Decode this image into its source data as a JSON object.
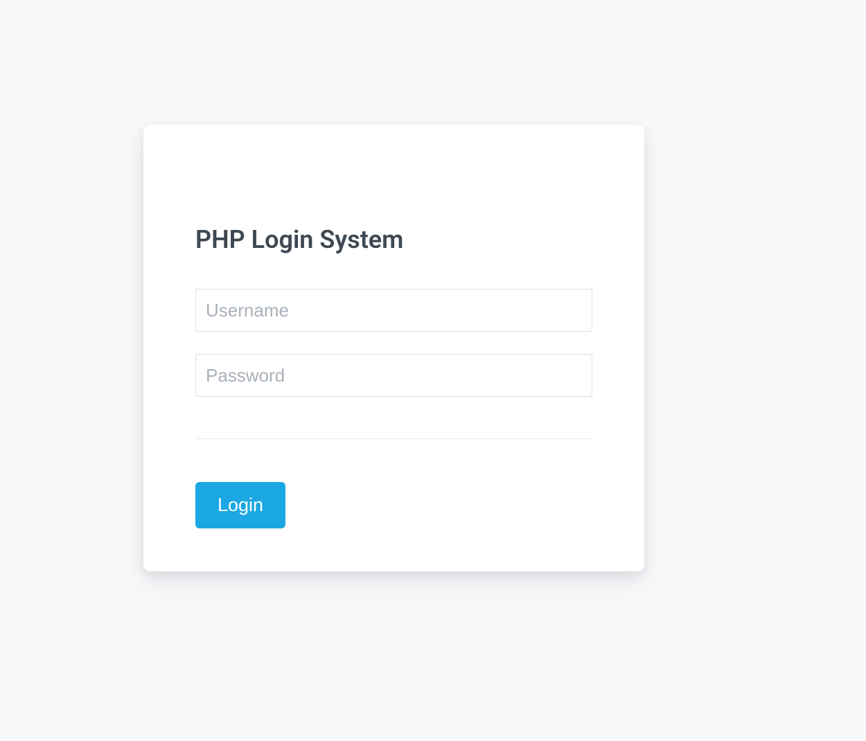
{
  "form": {
    "title": "PHP Login System",
    "username_placeholder": "Username",
    "password_placeholder": "Password",
    "login_button_label": "Login"
  }
}
